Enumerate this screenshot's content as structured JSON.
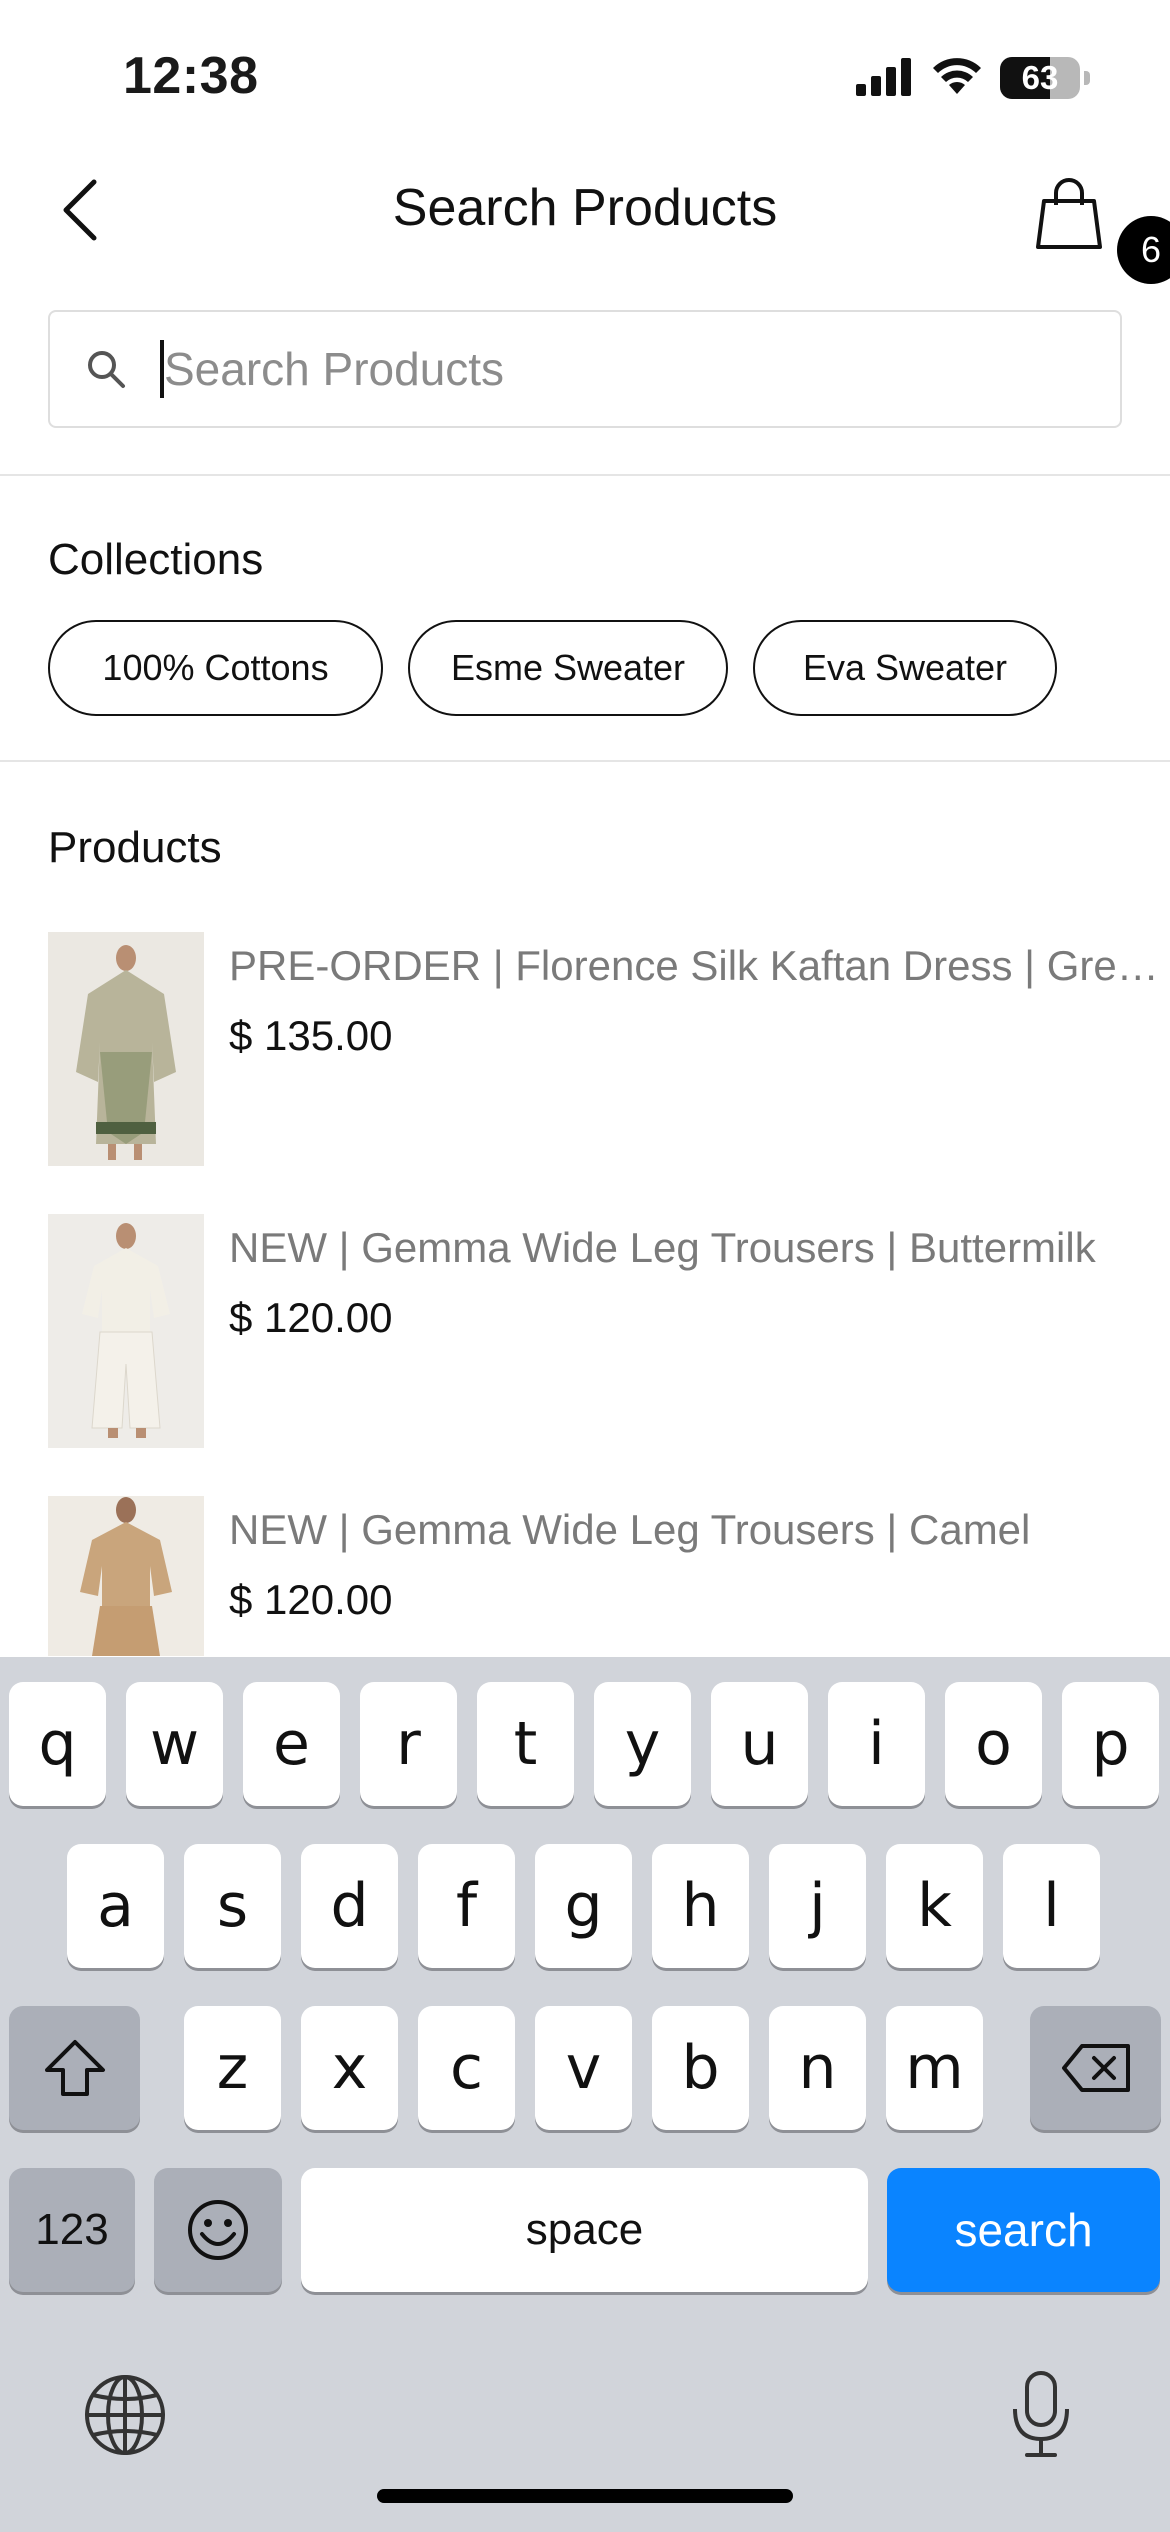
{
  "status_bar": {
    "time": "12:38",
    "battery": "63"
  },
  "header": {
    "title": "Search Products",
    "cart_count": "6"
  },
  "search": {
    "placeholder": "Search Products",
    "value": ""
  },
  "collections": {
    "heading": "Collections",
    "chips": [
      "100% Cottons",
      "Esme Sweater",
      "Eva Sweater"
    ]
  },
  "products": {
    "heading": "Products",
    "items": [
      {
        "name": "PRE-ORDER | Florence Silk Kaftan Dress | Green Palm",
        "price": "$ 135.00"
      },
      {
        "name": "NEW | Gemma Wide Leg Trousers | Buttermilk",
        "price": "$ 120.00"
      },
      {
        "name": "NEW | Gemma Wide Leg Trousers | Camel",
        "price": "$ 120.00"
      }
    ]
  },
  "keyboard": {
    "row1": [
      "q",
      "w",
      "e",
      "r",
      "t",
      "y",
      "u",
      "i",
      "o",
      "p"
    ],
    "row2": [
      "a",
      "s",
      "d",
      "f",
      "g",
      "h",
      "j",
      "k",
      "l"
    ],
    "row3": [
      "z",
      "x",
      "c",
      "v",
      "b",
      "n",
      "m"
    ],
    "numbers_label": "123",
    "space_label": "space",
    "action_label": "search"
  },
  "colors": {
    "accent": "#0a84ff",
    "keyboard_bg": "#d1d4da"
  }
}
